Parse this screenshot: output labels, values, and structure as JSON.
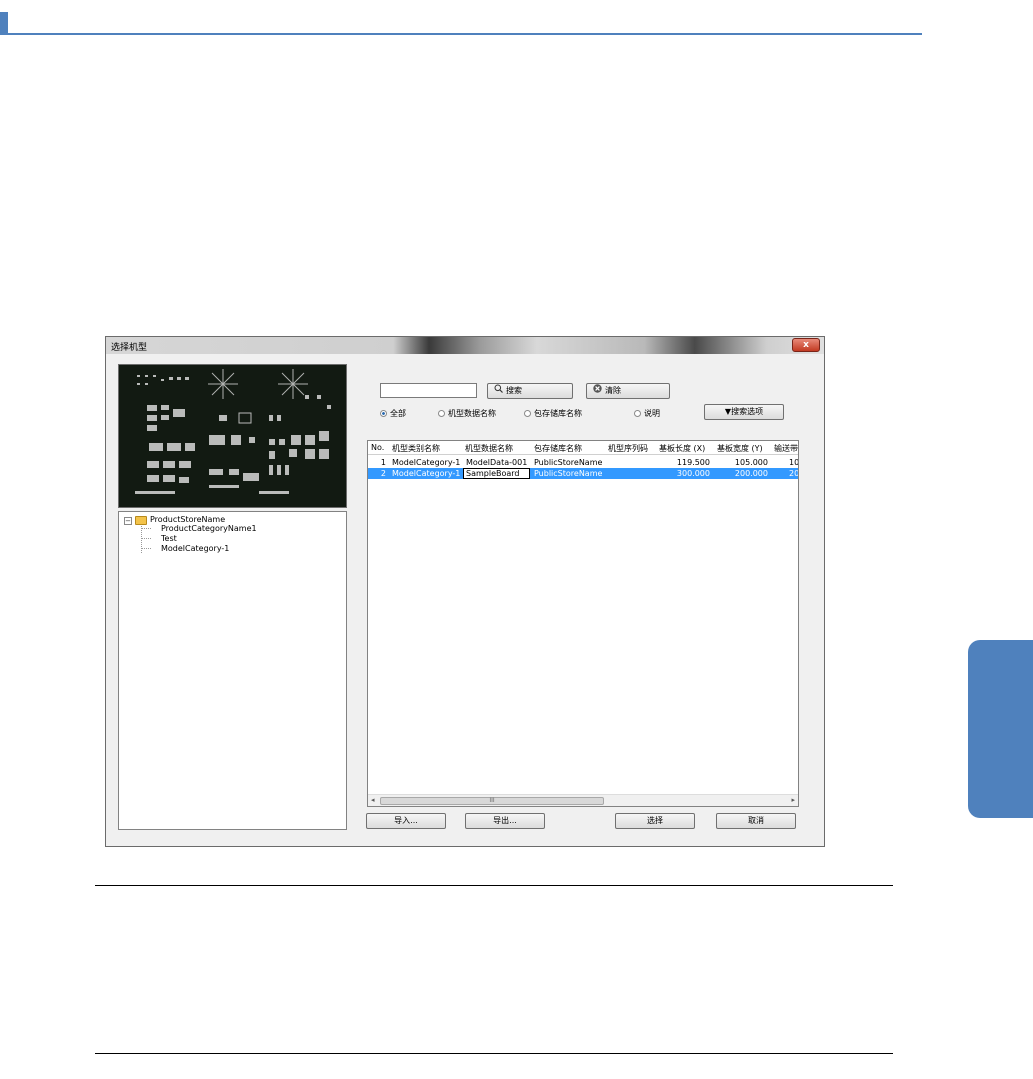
{
  "dialog": {
    "title": "选择机型",
    "close_symbol": "x"
  },
  "tree": {
    "root": "ProductStoreName",
    "children": [
      "ProductCategoryName1",
      "Test",
      "ModelCategory-1"
    ]
  },
  "search": {
    "value": "",
    "search_label": "搜索",
    "clear_label": "清除",
    "options_label": "▼搜索选项",
    "radios": [
      {
        "label": "全部",
        "selected": true
      },
      {
        "label": "机型数据名称",
        "selected": false
      },
      {
        "label": "包存储库名称",
        "selected": false
      },
      {
        "label": "说明",
        "selected": false
      }
    ]
  },
  "table": {
    "headers": [
      "No.",
      "机型类别名称",
      "机型数据名称",
      "包存储库名称",
      "机型序列码",
      "基板长度 (X)",
      "基板宽度 (Y)",
      "输送带"
    ],
    "rows": [
      [
        "1",
        "ModelCategory-1",
        "ModelData-001",
        "PublicStoreName",
        "",
        "119.500",
        "105.000",
        "10"
      ],
      [
        "2",
        "ModelCategory-1",
        "SampleBoard",
        "PublicStoreName",
        "",
        "300.000",
        "200.000",
        "20"
      ]
    ],
    "selected_row": 1,
    "scroll_label": "III"
  },
  "buttons": {
    "import": "导入...",
    "export": "导出...",
    "select": "选择",
    "cancel": "取消"
  },
  "colors": {
    "accent": "#4f81bd",
    "selection": "#3399ff"
  }
}
